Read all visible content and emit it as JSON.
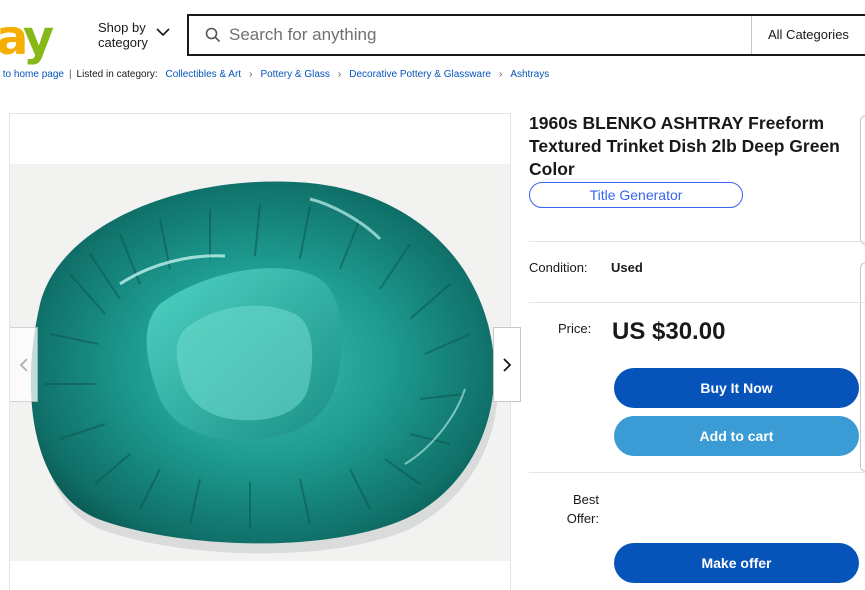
{
  "header": {
    "logo": {
      "a": "a",
      "y": "y"
    },
    "shop_by_label_1": "Shop by",
    "shop_by_label_2": "category",
    "search_placeholder": "Search for anything",
    "all_categories": "All Categories"
  },
  "breadcrumb": {
    "back": "ck to home page",
    "listed_in": "Listed in category:",
    "items": [
      "Collectibles & Art",
      "Pottery & Glass",
      "Decorative Pottery & Glassware",
      "Ashtrays"
    ]
  },
  "listing": {
    "title": "1960s BLENKO ASHTRAY Freeform Textured Trinket Dish 2lb Deep Green Color",
    "title_generator": "Title Generator",
    "condition_label": "Condition:",
    "condition_value": "Used",
    "price_label": "Price:",
    "price_value": "US $30.00",
    "buy_now": "Buy It Now",
    "add_to_cart": "Add to cart",
    "best_offer_label_1": "Best",
    "best_offer_label_2": "Offer:",
    "make_offer": "Make offer"
  },
  "icons": {
    "search": "search-icon",
    "chevron": "chevron-down-icon",
    "prev": "chevron-left-icon",
    "next": "chevron-right-icon"
  },
  "colors": {
    "primary_button": "#0654ba",
    "secondary_button": "#3a9bd5",
    "link": "#0654ba",
    "accent": "#3665f3",
    "glass": "#1a8f86"
  }
}
